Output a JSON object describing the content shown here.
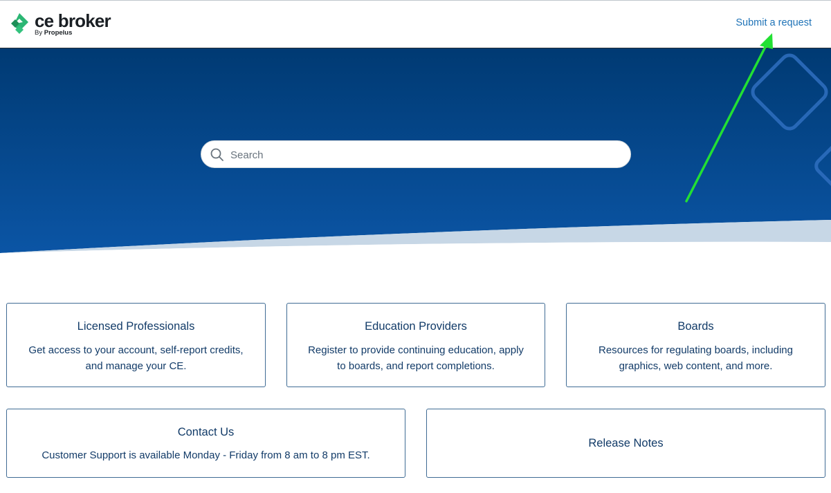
{
  "header": {
    "logo_name": "ce broker",
    "logo_by": "By",
    "logo_company": "Propelus",
    "submit_request": "Submit a request"
  },
  "search": {
    "placeholder": "Search"
  },
  "cards": [
    {
      "title": "Licensed Professionals",
      "description": "Get access to your account, self-report credits, and manage your CE."
    },
    {
      "title": "Education Providers",
      "description": "Register to provide continuing education, apply to boards, and report completions."
    },
    {
      "title": "Boards",
      "description": "Resources for regulating boards, including graphics, web content, and more."
    },
    {
      "title": "Contact Us",
      "description": "Customer Support is available Monday - Friday from 8 am to 8 pm EST."
    },
    {
      "title": "Release Notes",
      "description": ""
    }
  ],
  "icons": {
    "logo": "ce-broker-logo-mark",
    "search": "search-icon"
  },
  "colors": {
    "hero_dark": "#003a73",
    "hero_light": "#0b55a5",
    "accent_green": "#2bb673",
    "link_blue": "#1f73b7",
    "card_text": "#123b68",
    "annotation_arrow": "#22e033"
  }
}
